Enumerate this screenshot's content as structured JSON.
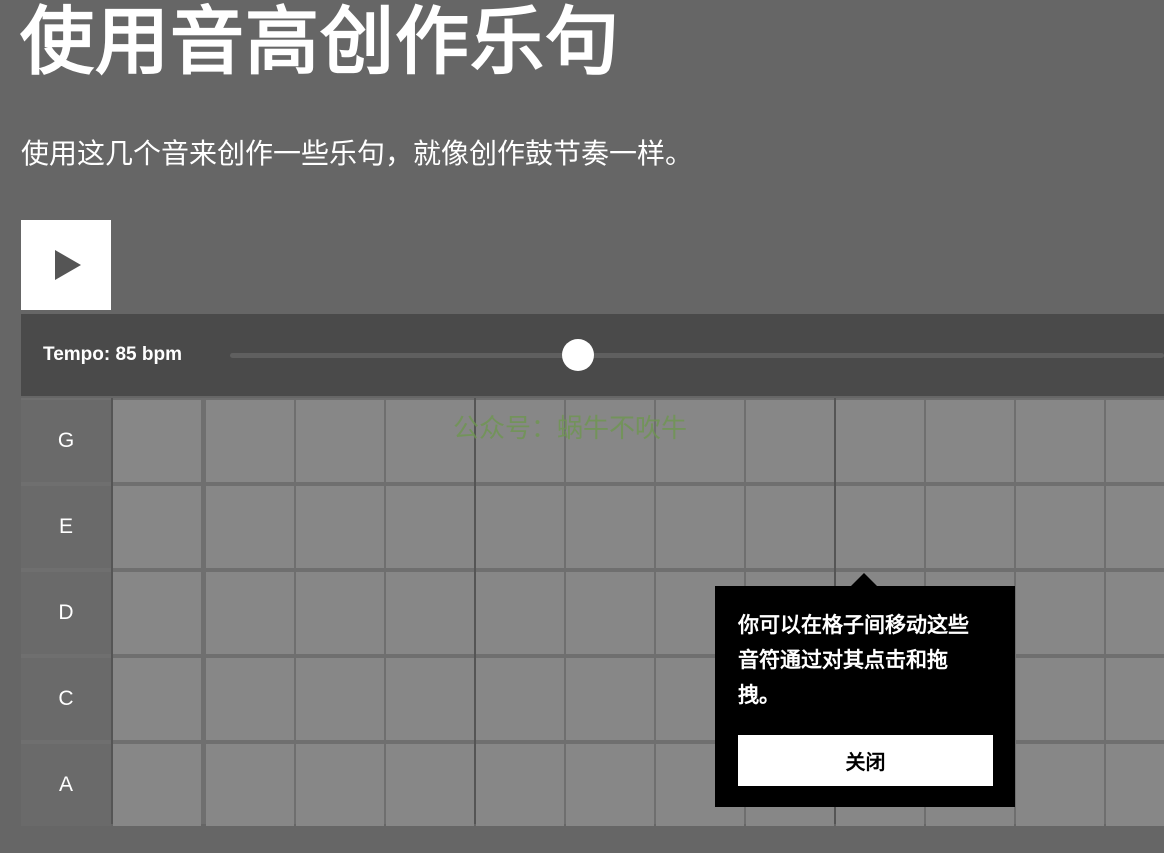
{
  "page": {
    "title": "使用音高创作乐句",
    "subtitle": "使用这几个音来创作一些乐句，就像创作鼓节奏一样。"
  },
  "player": {
    "play_icon": "play-icon",
    "tempo_label": "Tempo: 85 bpm",
    "tempo_value_bpm": 85
  },
  "grid": {
    "notes": [
      "G",
      "E",
      "D",
      "C",
      "A"
    ],
    "visible_steps": 12
  },
  "watermark": "公众号：蜗牛不吹牛",
  "tooltip": {
    "text": "你可以在格子间移动这些音符通过对其点击和拖拽。",
    "close_label": "关闭"
  },
  "colors": {
    "background": "#666666",
    "tempo_bar": "#4a4a4a",
    "cell": "#878787",
    "tooltip": "#000000",
    "accent": "#ffffff"
  }
}
